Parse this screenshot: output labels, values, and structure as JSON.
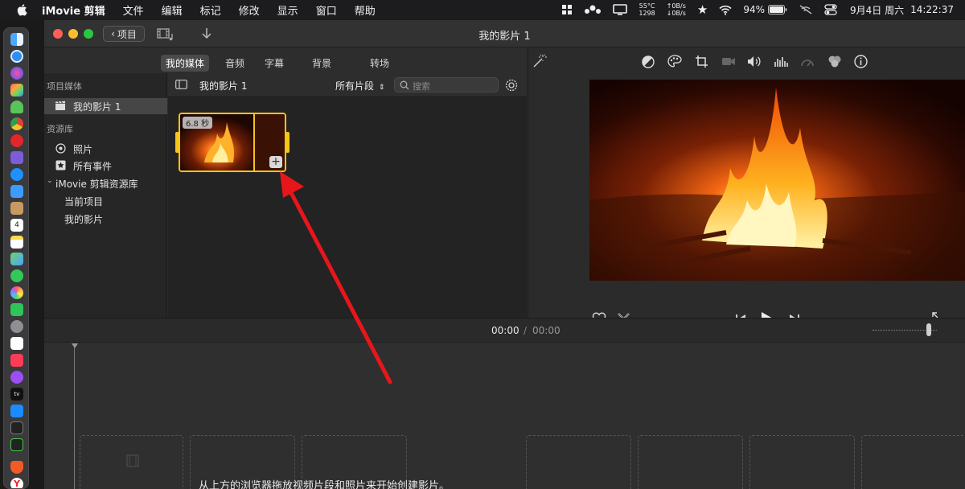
{
  "menubar": {
    "app_name": "iMovie 剪辑",
    "items": [
      "文件",
      "编辑",
      "标记",
      "修改",
      "显示",
      "窗口",
      "帮助"
    ],
    "temp": "55°C",
    "fan": "1298",
    "net_up": "↑0B/s",
    "net_down": "↓0B/s",
    "battery": "94%",
    "date": "9月4日 周六",
    "time": "14:22:37"
  },
  "window": {
    "back_label": "项目",
    "title": "我的影片 1"
  },
  "tabs": [
    "我的媒体",
    "音频",
    "字幕",
    "背景",
    "转场"
  ],
  "sidebar": {
    "project_media_header": "项目媒体",
    "project_item": "我的影片 1",
    "library_header": "资源库",
    "photos": "照片",
    "all_events": "所有事件",
    "library_name": "iMovie 剪辑资源库",
    "current_project": "当前项目",
    "my_movies": "我的影片"
  },
  "browser": {
    "title": "我的影片 1",
    "filter": "所有片段",
    "search_placeholder": "搜索",
    "clip_duration": "6.8 秒"
  },
  "timeline": {
    "current_time": "00:00",
    "separator": "/",
    "total_time": "00:00",
    "hint": "从上方的浏览器拖放视频片段和照片来开始创建影片。"
  },
  "colors": {
    "accent_yellow": "#f5c518",
    "arrow_red": "#e8161b",
    "close": "#ff5f57",
    "minimize": "#febc2e",
    "zoom": "#28c840"
  }
}
